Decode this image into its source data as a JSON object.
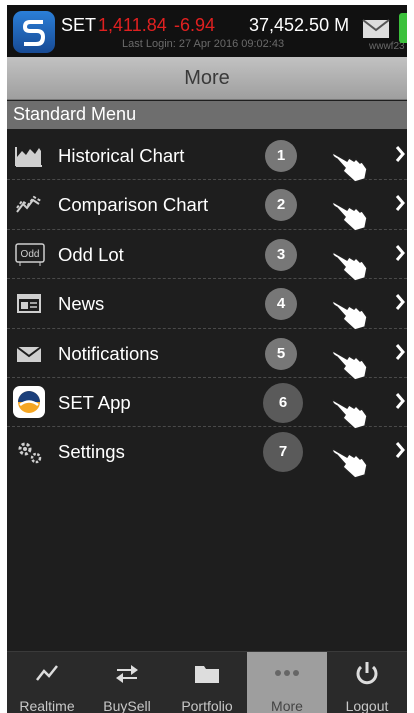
{
  "status_bar": {
    "exchange": "SET",
    "index": "1,411.84",
    "change": "-6.94",
    "volume": "37,452.50 M",
    "last_login": "Last Login: 27 Apr 2016 09:02:43",
    "user": "wwwf23",
    "index_color": "#e02020"
  },
  "title": "More",
  "section_header": "Standard Menu",
  "menu": [
    {
      "label": "Historical Chart",
      "number": "1",
      "icon": "area-chart-icon"
    },
    {
      "label": "Comparison Chart",
      "number": "2",
      "icon": "comparison-chart-icon"
    },
    {
      "label": "Odd Lot",
      "number": "3",
      "icon": "odd-lot-icon"
    },
    {
      "label": "News",
      "number": "4",
      "icon": "news-icon"
    },
    {
      "label": "Notifications",
      "number": "5",
      "icon": "envelope-icon"
    },
    {
      "label": "SET App",
      "number": "6",
      "icon": "set-app-icon"
    },
    {
      "label": "Settings",
      "number": "7",
      "icon": "gears-icon"
    }
  ],
  "odd_icon_text": "Odd",
  "bottom_nav": [
    {
      "label": "Realtime",
      "icon": "line-chart-icon",
      "active": false
    },
    {
      "label": "BuySell",
      "icon": "swap-arrows-icon",
      "active": false
    },
    {
      "label": "Portfolio",
      "icon": "folder-icon",
      "active": false
    },
    {
      "label": "More",
      "icon": "more-dots-icon",
      "active": true
    },
    {
      "label": "Logout",
      "icon": "power-icon",
      "active": false
    }
  ]
}
